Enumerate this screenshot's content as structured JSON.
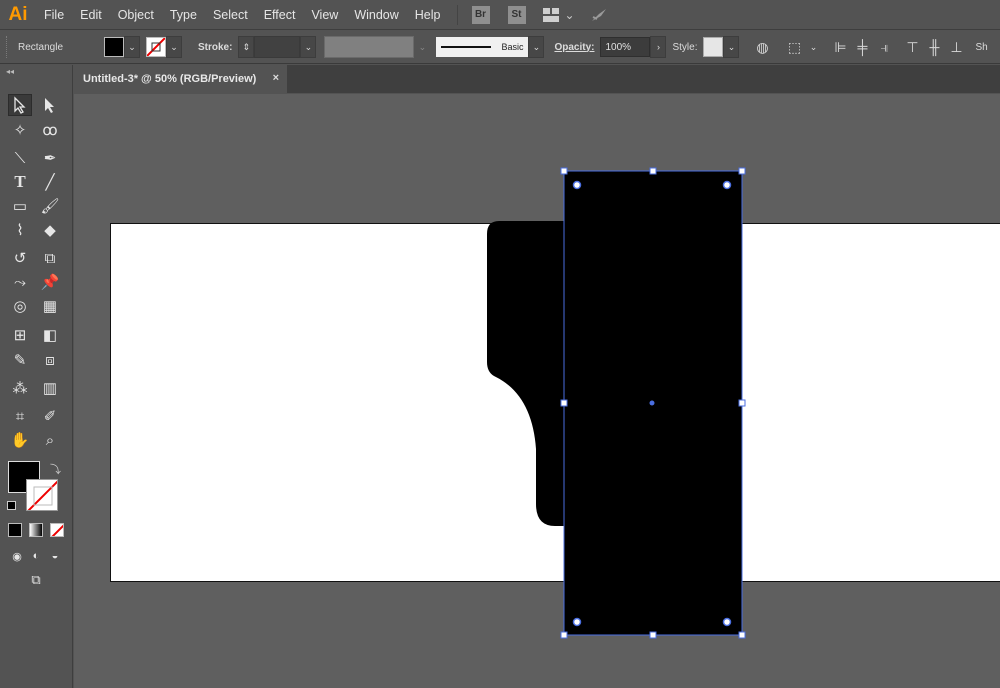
{
  "app": {
    "logo": "Ai"
  },
  "menu": [
    "File",
    "Edit",
    "Object",
    "Type",
    "Select",
    "Effect",
    "View",
    "Window",
    "Help"
  ],
  "bridge": {
    "br": "Br",
    "st": "St"
  },
  "control": {
    "selection_label": "Rectangle",
    "stroke_label": "Stroke:",
    "brush_label": "Basic",
    "opacity_label": "Opacity:",
    "opacity_value": "100%",
    "style_label": "Style:",
    "overflow_label": "Sh"
  },
  "document": {
    "tab_title": "Untitled-3* @ 50% (RGB/Preview)",
    "close": "×"
  },
  "colors": {
    "fill": "#000000",
    "stroke": "none",
    "selection": "#4a6ee0"
  }
}
